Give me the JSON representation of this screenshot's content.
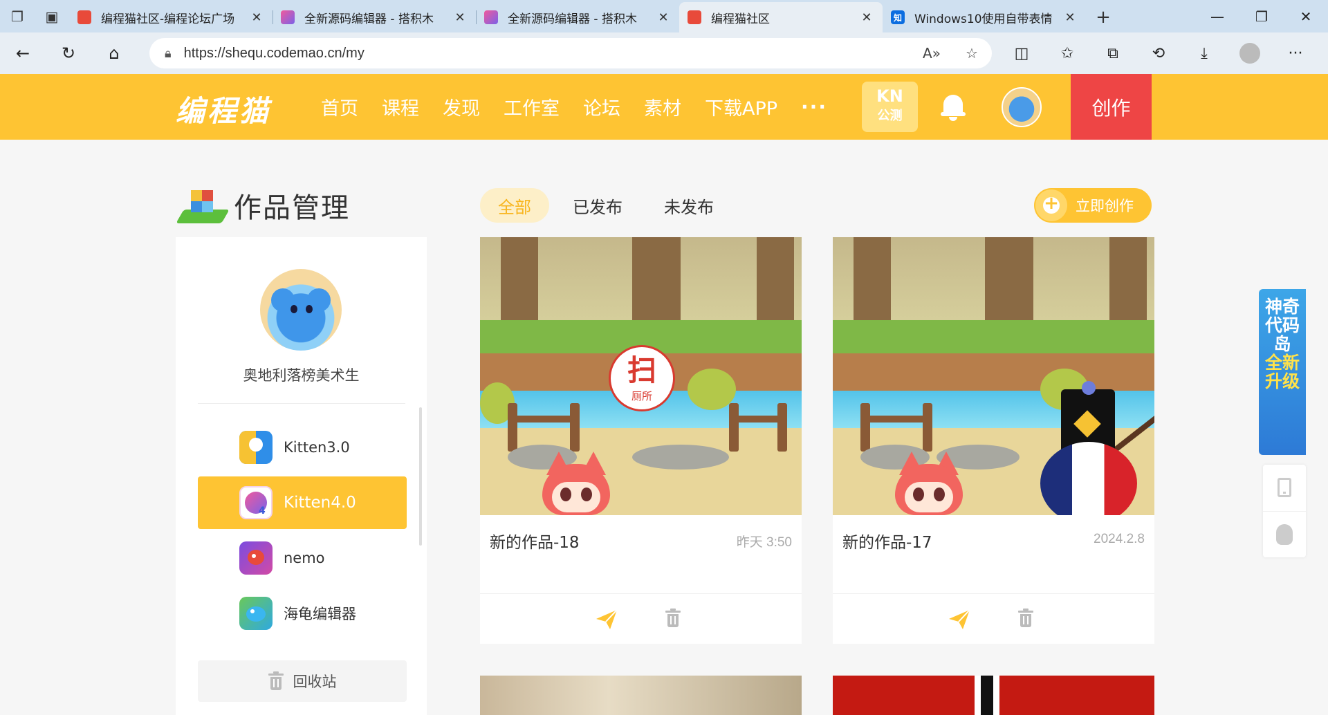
{
  "browser": {
    "tabs": [
      {
        "title": "编程猫社区-编程论坛广场",
        "favicon": "codemao-icon",
        "active": false
      },
      {
        "title": "全新源码编辑器 - 搭积木",
        "favicon": "kitten-icon",
        "active": false
      },
      {
        "title": "全新源码编辑器 - 搭积木",
        "favicon": "kitten-icon",
        "active": false
      },
      {
        "title": "编程猫社区",
        "favicon": "codemao-icon",
        "active": true
      },
      {
        "title": "Windows10使用自带表情",
        "favicon": "zhihu-icon",
        "favicon_text": "知",
        "active": false
      }
    ],
    "url": "https://shequ.codemao.cn/my"
  },
  "site": {
    "logo": "编程猫",
    "nav": [
      "首页",
      "课程",
      "发现",
      "工作室",
      "论坛",
      "素材",
      "下载APP"
    ],
    "more": "···",
    "kn_badge": {
      "top": "KN",
      "bottom": "公测"
    },
    "create": "创作"
  },
  "page": {
    "title": "作品管理",
    "filters": [
      {
        "label": "全部",
        "active": true
      },
      {
        "label": "已发布",
        "active": false
      },
      {
        "label": "未发布",
        "active": false
      }
    ],
    "now_create": "立即创作"
  },
  "sidebar": {
    "username": "奥地利落榜美术生",
    "editors": [
      {
        "label": "Kitten3.0",
        "active": false
      },
      {
        "label": "Kitten4.0",
        "active": true
      },
      {
        "label": "nemo",
        "active": false
      },
      {
        "label": "海龟编辑器",
        "active": false
      }
    ],
    "recycle": "回收站"
  },
  "works": [
    {
      "title": "新的作品-18",
      "date": "昨天 3:50",
      "stamp": {
        "big": "扫",
        "small": "厕所"
      }
    },
    {
      "title": "新的作品-17",
      "date": "2024.2.8"
    }
  ],
  "float_banner": {
    "line1": "神奇代码岛",
    "line2": "全新升级"
  },
  "colors": {
    "brand": "#fec433",
    "create": "#ee4545",
    "active_filter_text": "#f8b51e"
  }
}
